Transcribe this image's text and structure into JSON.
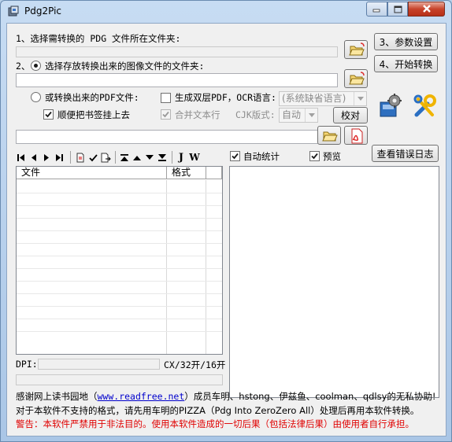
{
  "window": {
    "title": "Pdg2Pic",
    "icon": "app-icon",
    "controls": [
      "minimize-icon",
      "maximize-icon",
      "close-icon"
    ]
  },
  "step1": {
    "label": "1、选择需转换的 PDG 文件所在文件夹:",
    "path_value": ""
  },
  "step2": {
    "label": "2、",
    "option_folder_label": "选择存放转换出来的图像文件的文件夹:",
    "path_value": ""
  },
  "pdf_options": {
    "option_pdf_label": "或转换出来的PDF文件:",
    "bookmark_label": "顺便把书签挂上去",
    "bookmark_checked": true,
    "dual_layer_label": "生成双层PDF，OCR语言:",
    "dual_layer_checked": false,
    "ocr_lang_value": "(系统缺省语言)",
    "merge_lines_label": "合并文本行",
    "merge_lines_checked": true,
    "cjk_label": "CJK版式:",
    "cjk_value": "自动",
    "proofread_label": "校对",
    "pdf_path_value": ""
  },
  "buttons": {
    "settings": "3、参数设置",
    "start": "4、开始转换",
    "view_log": "查看错误日志"
  },
  "options": {
    "auto_stats_label": "自动统计",
    "auto_stats_checked": true,
    "preview_label": "预览",
    "preview_checked": true
  },
  "file_list": {
    "columns": [
      "文件",
      "格式"
    ],
    "rows": []
  },
  "status": {
    "dpi_label": "DPI:",
    "dpi_value": "",
    "size_text": "CX/32开/16开"
  },
  "footer": {
    "thanks_prefix": "感谢网上读书园地（",
    "thanks_link": "www.readfree.net",
    "thanks_suffix": "）成员车明、hstong、伊兹鱼、coolman、qdlsy的无私协助!",
    "note": "对于本软件不支持的格式，请先用车明的PIZZA（Pdg Into ZeroZero All）处理后再用本软件转换。",
    "warning": "警告：本软件严禁用于非法目的。使用本软件造成的一切后果（包括法律后果）由使用者自行承担。"
  },
  "colors": {
    "title_bar": "#b9d1ea",
    "warning_text": "#e00000",
    "link_text": "#0000cc",
    "close_button": "#c7432b"
  }
}
